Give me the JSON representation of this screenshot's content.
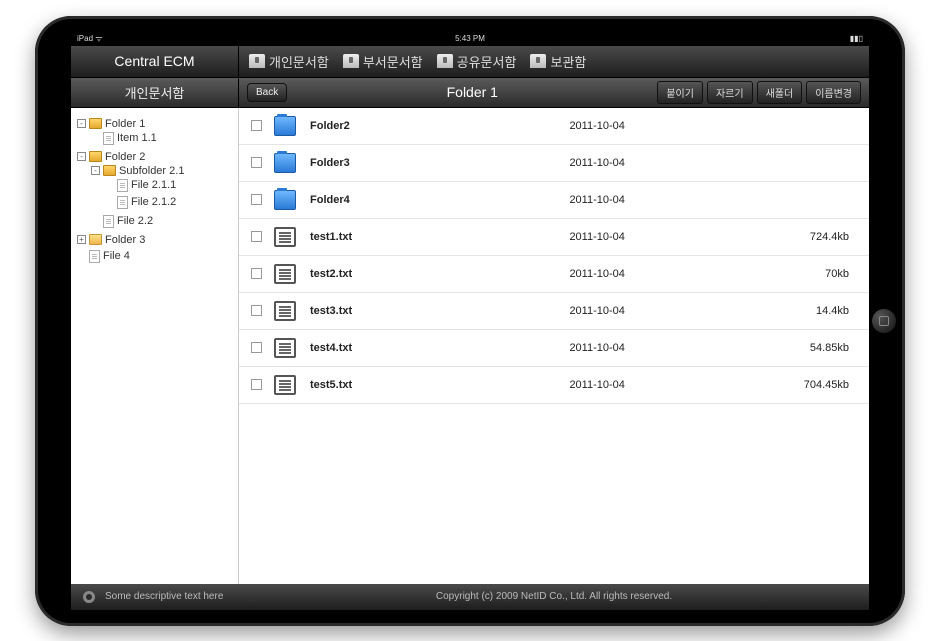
{
  "status": {
    "left": "iPad ᯤ",
    "center": "5:43 PM",
    "right": "▮▮▯"
  },
  "brand": "Central ECM",
  "nav_tabs": [
    "개인문서함",
    "부서문서함",
    "공유문서함",
    "보관함"
  ],
  "sidebar": {
    "title": "개인문서함"
  },
  "toolbar": {
    "back": "Back",
    "breadcrumb": "Folder 1",
    "actions": [
      "붙이기",
      "자르기",
      "새폴더",
      "이름변경"
    ]
  },
  "tree": [
    {
      "label": "Folder 1",
      "icon": "folder-open",
      "expander": "-",
      "children": [
        {
          "label": "Item 1.1",
          "icon": "file",
          "expander": ""
        }
      ]
    },
    {
      "label": "Folder 2",
      "icon": "folder-open",
      "expander": "-",
      "children": [
        {
          "label": "Subfolder 2.1",
          "icon": "folder-open",
          "expander": "-",
          "children": [
            {
              "label": "File 2.1.1",
              "icon": "file",
              "expander": ""
            },
            {
              "label": "File 2.1.2",
              "icon": "file",
              "expander": ""
            }
          ]
        },
        {
          "label": "File 2.2",
          "icon": "file",
          "expander": ""
        }
      ]
    },
    {
      "label": "Folder 3",
      "icon": "folder-closed",
      "expander": "+",
      "children": []
    },
    {
      "label": "File 4",
      "icon": "file",
      "expander": "",
      "children": []
    }
  ],
  "list": [
    {
      "name": "Folder2",
      "date": "2011-10-04",
      "size": "",
      "type": "folder"
    },
    {
      "name": "Folder3",
      "date": "2011-10-04",
      "size": "",
      "type": "folder"
    },
    {
      "name": "Folder4",
      "date": "2011-10-04",
      "size": "",
      "type": "folder"
    },
    {
      "name": "test1.txt",
      "date": "2011-10-04",
      "size": "724.4kb",
      "type": "file"
    },
    {
      "name": "test2.txt",
      "date": "2011-10-04",
      "size": "70kb",
      "type": "file"
    },
    {
      "name": "test3.txt",
      "date": "2011-10-04",
      "size": "14.4kb",
      "type": "file"
    },
    {
      "name": "test4.txt",
      "date": "2011-10-04",
      "size": "54.85kb",
      "type": "file"
    },
    {
      "name": "test5.txt",
      "date": "2011-10-04",
      "size": "704.45kb",
      "type": "file"
    }
  ],
  "footer": {
    "left_text": "Some descriptive text here",
    "copyright": "Copyright (c) 2009 NetID Co., Ltd. All rights reserved."
  }
}
